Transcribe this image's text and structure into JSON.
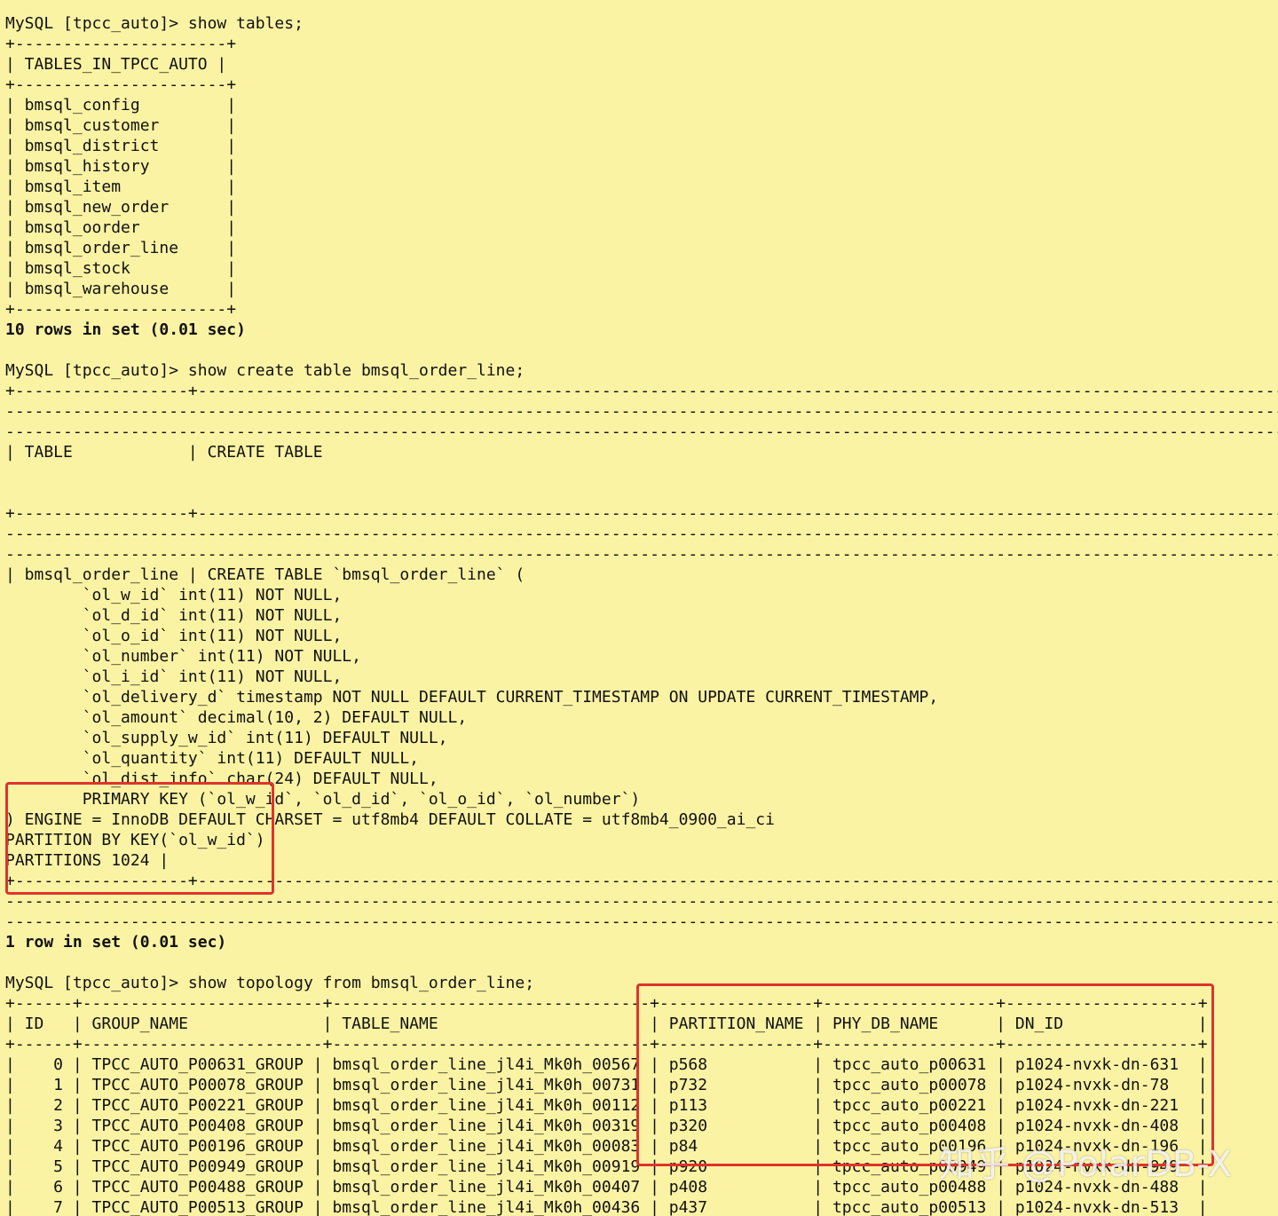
{
  "terminal": {
    "lines": [
      {
        "text": "MySQL [tpcc_auto]> show tables;",
        "bold": false
      },
      {
        "text": "+----------------------+",
        "bold": false
      },
      {
        "text": "| TABLES_IN_TPCC_AUTO |",
        "bold": false
      },
      {
        "text": "+----------------------+",
        "bold": false
      },
      {
        "text": "| bmsql_config         |",
        "bold": false
      },
      {
        "text": "| bmsql_customer       |",
        "bold": false
      },
      {
        "text": "| bmsql_district       |",
        "bold": false
      },
      {
        "text": "| bmsql_history        |",
        "bold": false
      },
      {
        "text": "| bmsql_item           |",
        "bold": false
      },
      {
        "text": "| bmsql_new_order      |",
        "bold": false
      },
      {
        "text": "| bmsql_oorder         |",
        "bold": false
      },
      {
        "text": "| bmsql_order_line     |",
        "bold": false
      },
      {
        "text": "| bmsql_stock          |",
        "bold": false
      },
      {
        "text": "| bmsql_warehouse      |",
        "bold": false
      },
      {
        "text": "+----------------------+",
        "bold": false
      },
      {
        "text": "10 rows in set (0.01 sec)",
        "bold": true
      },
      {
        "text": "",
        "bold": false
      },
      {
        "text": "MySQL [tpcc_auto]> show create table bmsql_order_line;",
        "bold": false
      },
      {
        "text": "+------------------+------------------------------------------------------------------------------------------------------------------------",
        "bold": false
      },
      {
        "text": "--------------------------------------------------------------------------------------------------------------------------------------------",
        "bold": false
      },
      {
        "text": "--------------------------------------------------------------------------------------------------------------------------------------------",
        "bold": false
      },
      {
        "text": "| TABLE            | CREATE TABLE",
        "bold": false
      },
      {
        "text": "",
        "bold": false
      },
      {
        "text": "",
        "bold": false
      },
      {
        "text": "+------------------+------------------------------------------------------------------------------------------------------------------------",
        "bold": false
      },
      {
        "text": "--------------------------------------------------------------------------------------------------------------------------------------------",
        "bold": false
      },
      {
        "text": "--------------------------------------------------------------------------------------------------------------------------------------------",
        "bold": false
      },
      {
        "text": "| bmsql_order_line | CREATE TABLE `bmsql_order_line` (",
        "bold": false
      },
      {
        "text": "        `ol_w_id` int(11) NOT NULL,",
        "bold": false
      },
      {
        "text": "        `ol_d_id` int(11) NOT NULL,",
        "bold": false
      },
      {
        "text": "        `ol_o_id` int(11) NOT NULL,",
        "bold": false
      },
      {
        "text": "        `ol_number` int(11) NOT NULL,",
        "bold": false
      },
      {
        "text": "        `ol_i_id` int(11) NOT NULL,",
        "bold": false
      },
      {
        "text": "        `ol_delivery_d` timestamp NOT NULL DEFAULT CURRENT_TIMESTAMP ON UPDATE CURRENT_TIMESTAMP,",
        "bold": false
      },
      {
        "text": "        `ol_amount` decimal(10, 2) DEFAULT NULL,",
        "bold": false
      },
      {
        "text": "        `ol_supply_w_id` int(11) DEFAULT NULL,",
        "bold": false
      },
      {
        "text": "        `ol_quantity` int(11) DEFAULT NULL,",
        "bold": false
      },
      {
        "text": "        `ol_dist_info` char(24) DEFAULT NULL,",
        "bold": false
      },
      {
        "text": "        PRIMARY KEY (`ol_w_id`, `ol_d_id`, `ol_o_id`, `ol_number`)",
        "bold": false
      },
      {
        "text": ") ENGINE = InnoDB DEFAULT CHARSET = utf8mb4 DEFAULT COLLATE = utf8mb4_0900_ai_ci",
        "bold": false
      },
      {
        "text": "PARTITION BY KEY(`ol_w_id`)",
        "bold": false
      },
      {
        "text": "PARTITIONS 1024 |",
        "bold": false
      },
      {
        "text": "+------------------+------------------------------------------------------------------------------------------------------------------------",
        "bold": false
      },
      {
        "text": "--------------------------------------------------------------------------------------------------------------------------------------------",
        "bold": false
      },
      {
        "text": "--------------------------------------------------------------------------------------------------------------------------------------------",
        "bold": false
      },
      {
        "text": "1 row in set (0.01 sec)",
        "bold": true
      },
      {
        "text": "",
        "bold": false
      },
      {
        "text": "MySQL [tpcc_auto]> show topology from bmsql_order_line;",
        "bold": false
      },
      {
        "text": "+------+-------------------------+---------------------------------+----------------+------------------+--------------------+",
        "bold": false
      },
      {
        "text": "| ID   | GROUP_NAME              | TABLE_NAME                      | PARTITION_NAME | PHY_DB_NAME      | DN_ID              |",
        "bold": false
      },
      {
        "text": "+------+-------------------------+---------------------------------+----------------+------------------+--------------------+",
        "bold": false
      },
      {
        "text": "|    0 | TPCC_AUTO_P00631_GROUP | bmsql_order_line_jl4i_Mk0h_00567 | p568           | tpcc_auto_p00631 | p1024-nvxk-dn-631  |",
        "bold": false
      },
      {
        "text": "|    1 | TPCC_AUTO_P00078_GROUP | bmsql_order_line_jl4i_Mk0h_00731 | p732           | tpcc_auto_p00078 | p1024-nvxk-dn-78   |",
        "bold": false
      },
      {
        "text": "|    2 | TPCC_AUTO_P00221_GROUP | bmsql_order_line_jl4i_Mk0h_00112 | p113           | tpcc_auto_p00221 | p1024-nvxk-dn-221  |",
        "bold": false
      },
      {
        "text": "|    3 | TPCC_AUTO_P00408_GROUP | bmsql_order_line_jl4i_Mk0h_00319 | p320           | tpcc_auto_p00408 | p1024-nvxk-dn-408  |",
        "bold": false
      },
      {
        "text": "|    4 | TPCC_AUTO_P00196_GROUP | bmsql_order_line_jl4i_Mk0h_00083 | p84            | tpcc_auto_p00196 | p1024-nvxk-dn-196  |",
        "bold": false
      },
      {
        "text": "|    5 | TPCC_AUTO_P00949_GROUP | bmsql_order_line_jl4i_Mk0h_00919 | p920           | tpcc_auto_p00949 | p1024-nvxk-dn-949  |",
        "bold": false
      },
      {
        "text": "|    6 | TPCC_AUTO_P00488_GROUP | bmsql_order_line_jl4i_Mk0h_00407 | p408           | tpcc_auto_p00488 | p1024-nvxk-dn-488  |",
        "bold": false
      },
      {
        "text": "|    7 | TPCC_AUTO_P00513_GROUP | bmsql_order_line_jl4i_Mk0h_00436 | p437           | tpcc_auto_p00513 | p1024-nvxk-dn-513  |",
        "bold": false
      }
    ]
  },
  "watermark": "知乎 @PolarDB-X",
  "colors": {
    "background": "#fbf3a4",
    "text": "#111111",
    "highlight_border": "#e0332d"
  }
}
